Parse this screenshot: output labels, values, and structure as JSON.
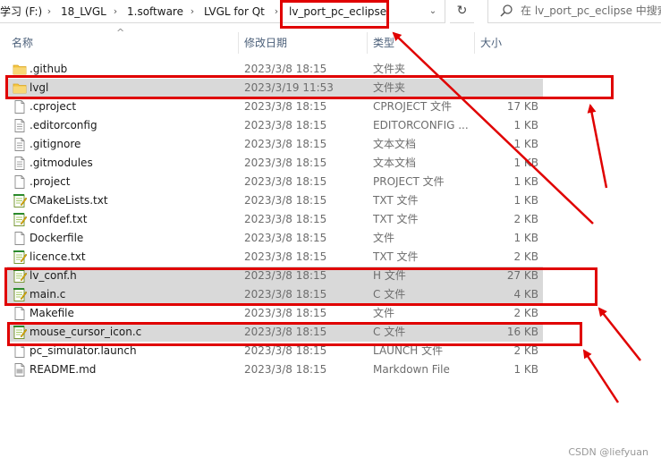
{
  "address_bar": {
    "crumbs": [
      "学习 (F:)",
      "18_LVGL",
      "1.software",
      "LVGL for Qt",
      "lv_port_pc_eclipse"
    ],
    "separator": "›",
    "dropdown_icon": "chevron-down-icon",
    "refresh_icon": "refresh-icon"
  },
  "search": {
    "placeholder": "在 lv_port_pc_eclipse 中搜索",
    "icon": "search-icon"
  },
  "columns": {
    "name": "名称",
    "date": "修改日期",
    "type": "类型",
    "size": "大小",
    "sort_indicator": "^"
  },
  "files": [
    {
      "name": ".github",
      "date": "2023/3/8 18:15",
      "type": "文件夹",
      "size": "",
      "icon": "folder-icon",
      "selected": false
    },
    {
      "name": "lvgl",
      "date": "2023/3/19 11:53",
      "type": "文件夹",
      "size": "",
      "icon": "folder-icon",
      "selected": true
    },
    {
      "name": ".cproject",
      "date": "2023/3/8 18:15",
      "type": "CPROJECT 文件",
      "size": "17 KB",
      "icon": "file-icon",
      "selected": false
    },
    {
      "name": ".editorconfig",
      "date": "2023/3/8 18:15",
      "type": "EDITORCONFIG ...",
      "size": "1 KB",
      "icon": "text-file-icon",
      "selected": false
    },
    {
      "name": ".gitignore",
      "date": "2023/3/8 18:15",
      "type": "文本文档",
      "size": "1 KB",
      "icon": "text-file-icon",
      "selected": false
    },
    {
      "name": ".gitmodules",
      "date": "2023/3/8 18:15",
      "type": "文本文档",
      "size": "1 KB",
      "icon": "text-file-icon",
      "selected": false
    },
    {
      "name": ".project",
      "date": "2023/3/8 18:15",
      "type": "PROJECT 文件",
      "size": "1 KB",
      "icon": "file-icon",
      "selected": false
    },
    {
      "name": "CMakeLists.txt",
      "date": "2023/3/8 18:15",
      "type": "TXT 文件",
      "size": "1 KB",
      "icon": "notepad-file-icon",
      "selected": false
    },
    {
      "name": "confdef.txt",
      "date": "2023/3/8 18:15",
      "type": "TXT 文件",
      "size": "2 KB",
      "icon": "notepad-file-icon",
      "selected": false
    },
    {
      "name": "Dockerfile",
      "date": "2023/3/8 18:15",
      "type": "文件",
      "size": "1 KB",
      "icon": "file-icon",
      "selected": false
    },
    {
      "name": "licence.txt",
      "date": "2023/3/8 18:15",
      "type": "TXT 文件",
      "size": "2 KB",
      "icon": "notepad-file-icon",
      "selected": false
    },
    {
      "name": "lv_conf.h",
      "date": "2023/3/8 18:15",
      "type": "H 文件",
      "size": "27 KB",
      "icon": "notepad-file-icon",
      "selected": true
    },
    {
      "name": "main.c",
      "date": "2023/3/8 18:15",
      "type": "C 文件",
      "size": "4 KB",
      "icon": "notepad-file-icon",
      "selected": true
    },
    {
      "name": "Makefile",
      "date": "2023/3/8 18:15",
      "type": "文件",
      "size": "2 KB",
      "icon": "file-icon",
      "selected": false
    },
    {
      "name": "mouse_cursor_icon.c",
      "date": "2023/3/8 18:15",
      "type": "C 文件",
      "size": "16 KB",
      "icon": "notepad-file-icon",
      "selected": true
    },
    {
      "name": "pc_simulator.launch",
      "date": "2023/3/8 18:15",
      "type": "LAUNCH 文件",
      "size": "2 KB",
      "icon": "file-icon",
      "selected": false
    },
    {
      "name": "README.md",
      "date": "2023/3/8 18:15",
      "type": "Markdown File",
      "size": "1 KB",
      "icon": "markdown-file-icon",
      "selected": false
    }
  ],
  "watermark": "CSDN @liefyuan",
  "colors": {
    "highlight": "#e00000",
    "selection": "#d9d9d9",
    "folder": "#f4c542"
  }
}
